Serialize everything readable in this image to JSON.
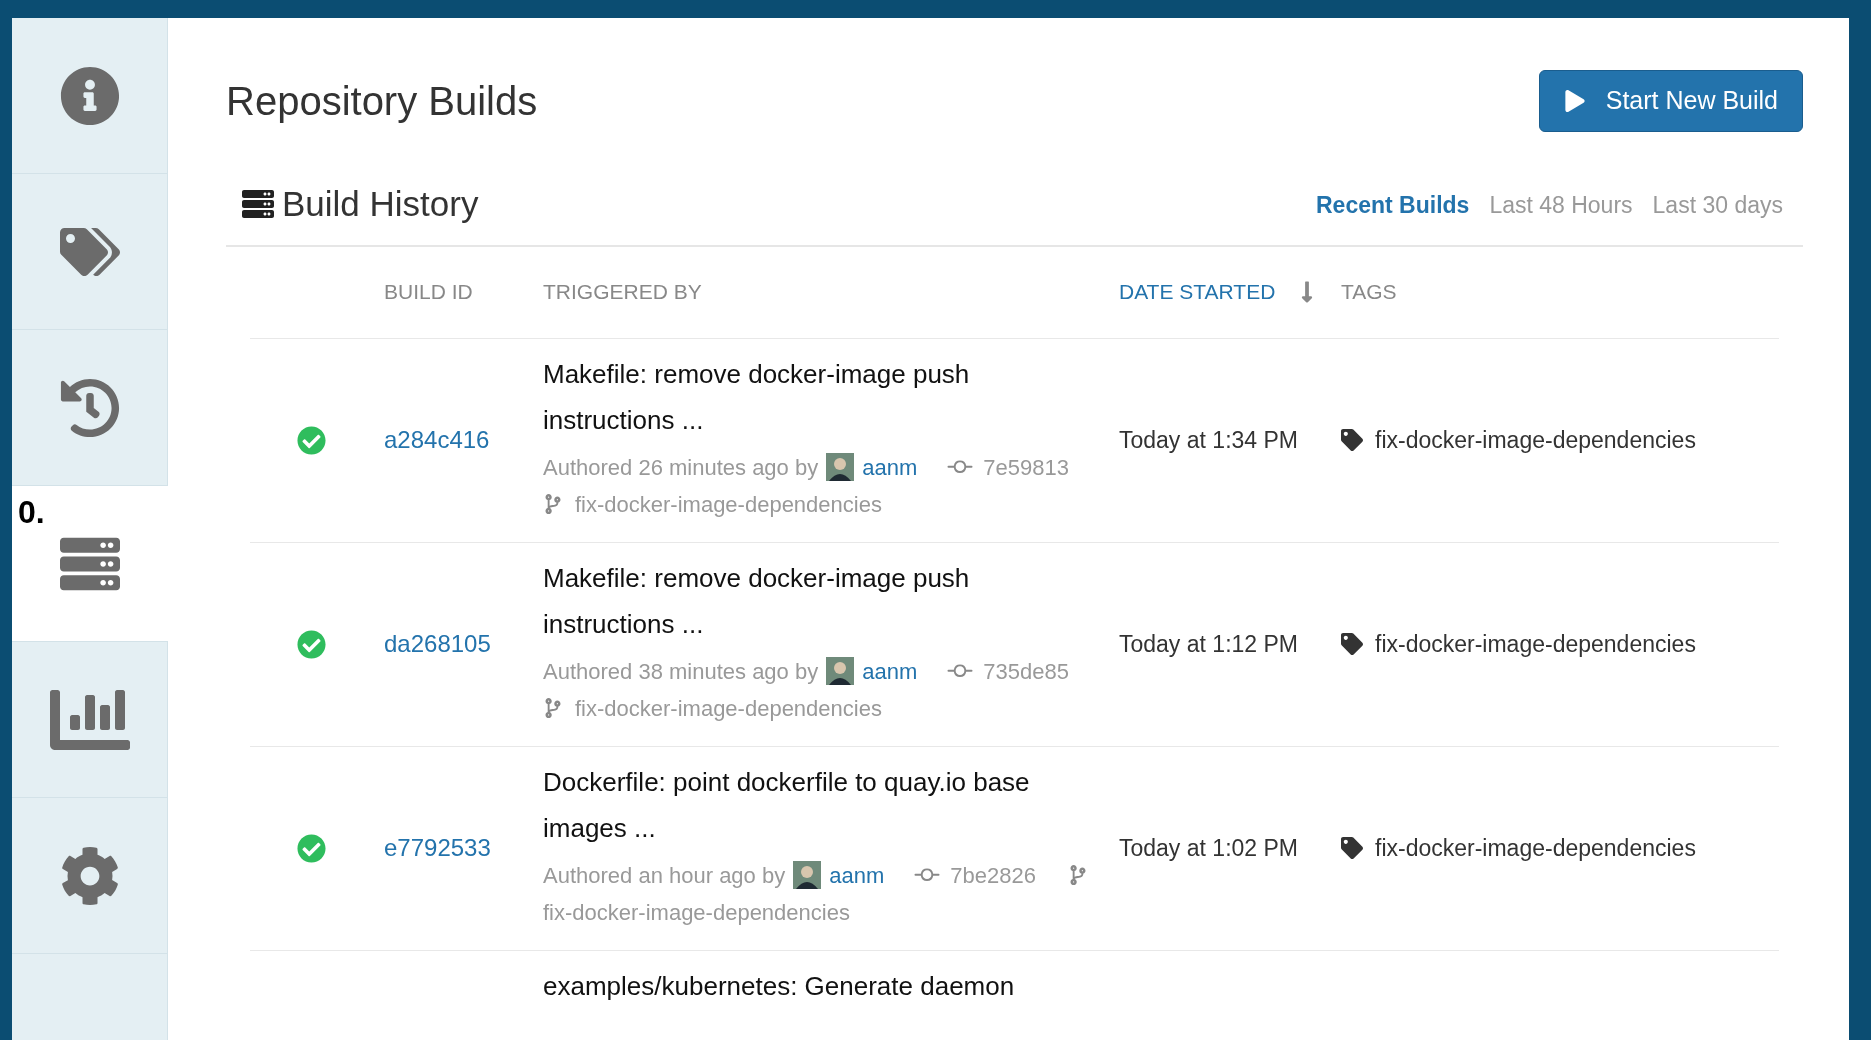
{
  "sidebar": {
    "items": [
      {
        "kind": "info",
        "selected": false
      },
      {
        "kind": "tags",
        "selected": false
      },
      {
        "kind": "history",
        "selected": false
      },
      {
        "kind": "builds",
        "selected": true,
        "label": "0."
      },
      {
        "kind": "usage",
        "selected": false
      },
      {
        "kind": "settings",
        "selected": false
      },
      {
        "kind": "blank"
      }
    ]
  },
  "page": {
    "title": "Repository Builds",
    "start_button": "Start New Build"
  },
  "build_history": {
    "title": "Build History",
    "filters": [
      {
        "label": "Recent Builds",
        "selected": true
      },
      {
        "label": "Last 48 Hours",
        "selected": false
      },
      {
        "label": "Last 30 days",
        "selected": false
      }
    ],
    "columns": [
      {
        "label": "BUILD ID",
        "sorted": false
      },
      {
        "label": "TRIGGERED BY",
        "sorted": false
      },
      {
        "label": "DATE STARTED",
        "sorted": true
      },
      {
        "label": "TAGS",
        "sorted": false
      }
    ],
    "rows": [
      {
        "passed": true,
        "build_id": "a284c416",
        "message": "Makefile: remove docker-image push instructions ...",
        "authored": "Authored 26 minutes ago by",
        "author": "aanm",
        "commit": "7e59813",
        "branch": "fix-docker-image-dependencies",
        "date": "Today at 1:34 PM",
        "tag": "fix-docker-image-dependencies"
      },
      {
        "passed": true,
        "build_id": "da268105",
        "message": "Makefile: remove docker-image push instructions ...",
        "authored": "Authored 38 minutes ago by",
        "author": "aanm",
        "commit": "735de85",
        "branch": "fix-docker-image-dependencies",
        "date": "Today at 1:12 PM",
        "tag": "fix-docker-image-dependencies"
      },
      {
        "passed": true,
        "build_id": "e7792533",
        "message": "Dockerfile: point dockerfile to quay.io base images ...",
        "authored": "Authored an hour ago by",
        "author": "aanm",
        "commit": "7be2826",
        "branch": "fix-docker-image-dependencies",
        "date": "Today at 1:02 PM",
        "tag": "fix-docker-image-dependencies"
      },
      {
        "message": "examples/kubernetes: Generate daemon"
      }
    ]
  }
}
